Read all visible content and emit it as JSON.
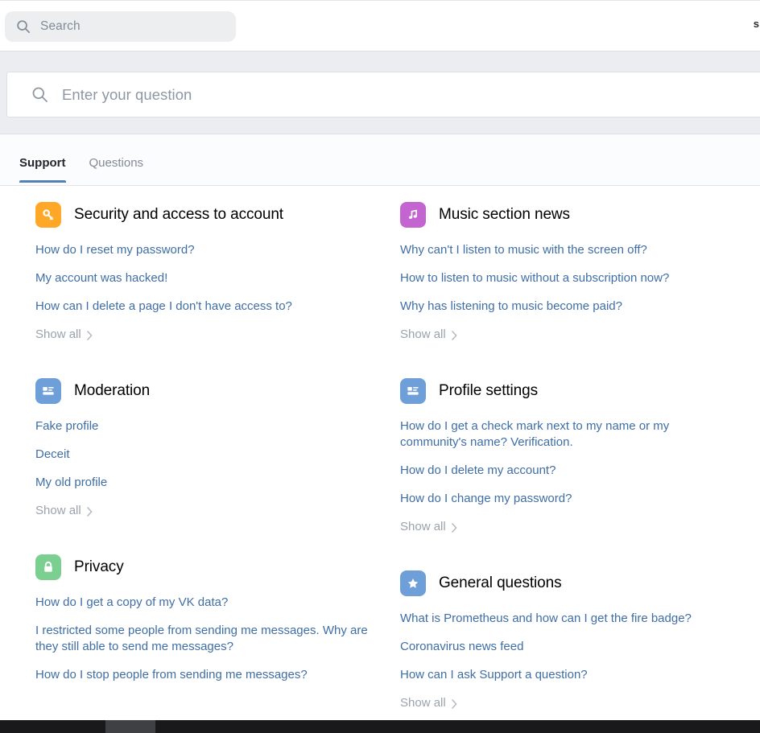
{
  "topbar": {
    "search": {
      "placeholder": "Search",
      "value": "",
      "icon": "search-icon"
    },
    "right_glyph": "s"
  },
  "question_search": {
    "placeholder": "Enter your question",
    "value": "",
    "icon": "search-icon"
  },
  "tabs": [
    {
      "label": "Support",
      "active": true
    },
    {
      "label": "Questions",
      "active": false
    }
  ],
  "show_all_label": "Show all",
  "colors": {
    "accent": "#5181b8",
    "link": "#3f6ea5",
    "muted": "#9aa3ad",
    "icon_orange": "#ffa726",
    "icon_purple": "#c364d0",
    "icon_blue": "#6f9fd8",
    "icon_green": "#7bcf91",
    "band": "#ebedf0",
    "topbar_field": "#edeef0",
    "scrollbar_track": "#19191b",
    "scrollbar_thumb": "#3e4043"
  },
  "categories": {
    "left": [
      {
        "title": "Security and access to account",
        "icon": "key-icon",
        "icon_color": "#ffa726",
        "links": [
          "How do I reset my password?",
          "My account was hacked!",
          "How can I delete a page I don't have access to?"
        ],
        "show_all": "Show all"
      },
      {
        "title": "Moderation",
        "icon": "id-card-icon",
        "icon_color": "#6f9fd8",
        "links": [
          "Fake profile",
          "Deceit",
          "My old profile"
        ],
        "show_all": "Show all"
      },
      {
        "title": "Privacy",
        "icon": "lock-icon",
        "icon_color": "#7bcf91",
        "links": [
          "How do I get a copy of my VK data?",
          "I restricted some people from sending me messages. Why are they still able to send me messages?",
          "How do I stop people from sending me messages?"
        ],
        "show_all": ""
      }
    ],
    "right": [
      {
        "title": "Music section news",
        "icon": "music-note-icon",
        "icon_color": "#c364d0",
        "links": [
          "Why can't I listen to music with the screen off?",
          "How to listen to music without a subscription now?",
          "Why has listening to music become paid?"
        ],
        "show_all": "Show all"
      },
      {
        "title": "Profile settings",
        "icon": "id-card-icon",
        "icon_color": "#6f9fd8",
        "links": [
          "How do I get a check mark next to my name or my community's name? Verification.",
          "How do I delete my account?",
          "How do I change my password?"
        ],
        "show_all": "Show all"
      },
      {
        "title": "General questions",
        "icon": "star-icon",
        "icon_color": "#6f9fd8",
        "links": [
          "What is Prometheus and how can I get the fire badge?",
          "Coronavirus news feed",
          "How can I ask Support a question?"
        ],
        "show_all": "Show all"
      }
    ]
  },
  "scrollbar": {
    "orientation": "horizontal"
  }
}
